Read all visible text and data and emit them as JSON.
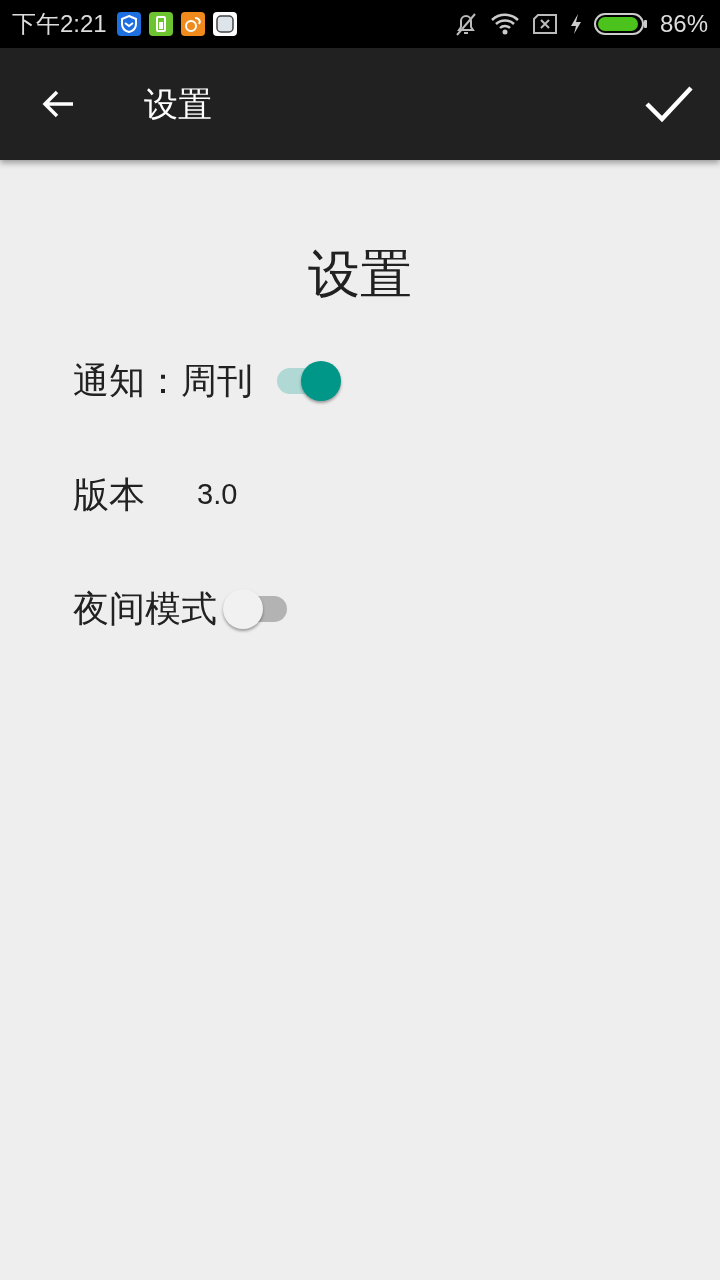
{
  "status_bar": {
    "time": "下午2:21",
    "battery_text": "86%"
  },
  "app_bar": {
    "title": "设置"
  },
  "heading": "设置",
  "settings": [
    {
      "kind": "toggle",
      "label": "通知：周刊",
      "on": true
    },
    {
      "kind": "value",
      "label": "版本",
      "value": "3.0"
    },
    {
      "kind": "toggle",
      "label": "夜间模式",
      "on": false
    }
  ]
}
